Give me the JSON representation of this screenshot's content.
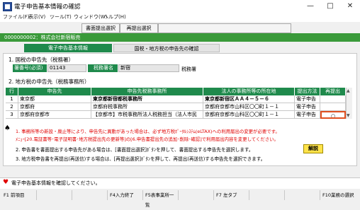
{
  "window": {
    "title": "電子申告基本情報の確認",
    "minimize_glyph": "—",
    "maximize_glyph": "□",
    "close_glyph": "✕"
  },
  "menu": [
    "ファイル(F)",
    "表示(V)",
    "ツール(T)",
    "ウィンドウ(W)",
    "ヘルプ(H)"
  ],
  "toolbar": {
    "button1": "書面提出選択",
    "button2": "再提出選択"
  },
  "company_line": "0000000002：株式会社新宿販売",
  "tabs": {
    "tab1": "電子申告基本情報",
    "tab2": "国税・地方税の申告先の確認"
  },
  "section1": {
    "title": "1. 国税の申告先（税務署）",
    "label_code": "署番号(必須)",
    "code_value": "01143",
    "label_office": "税務署名",
    "office_value": "新宿",
    "suffix": "税務署"
  },
  "section2": {
    "title": "2. 地方税の申告先（税務事務所）",
    "headers": [
      "行",
      "申告先",
      "申告先税務事務所",
      "法人の事務所等の所在地",
      "提出方法",
      "再提出"
    ],
    "rows": [
      {
        "no": "1",
        "dest": "東京都",
        "office": "東京都新宿都税事務所",
        "address": "東京都新宿区ＡＡ４－５－６",
        "method": "電子申告",
        "resubmit": ""
      },
      {
        "no": "2",
        "dest": "京都府",
        "office": "京都府税事務所",
        "address": "京都府京都市山科区〇〇町１－１",
        "method": "電子申告",
        "resubmit": ""
      },
      {
        "no": "3",
        "dest": "京都府京都市",
        "office": "【京都市】市税事務所法人税務担当（法人市民",
        "address": "京都府京都市山科区〇〇町１－１",
        "method": "電子申告",
        "resubmit": "○"
      }
    ]
  },
  "notes": {
    "note1_line1": "1. 事務所等の新設・廃止等により、申告先に異動があった場合は、必ず地方税ﾎﾟｰﾀﾙｼｽﾃﾑ(eLTAX)への利用届出の変更が必要です。",
    "note1_line2": "ﾒﾆｭｰ[20.電証書等･電子証明書･地方税提出先の更新等]の[6.申告書提出先の追加･削除･確認]で利用届出内容を変更してください。",
    "note2": "2. 申告書を書面提出する申告先がある場合は、[書面提出選択]ﾎﾞﾀﾝを押して、書面提出する申告先を選択します。",
    "note2_button": "解説",
    "note3": "3. 地方税申告書を再提出(再送信)する場合は、[再提出選択]ﾎﾞﾀﾝを押して、再提出(再送信)する申告先を選択できます。"
  },
  "status": {
    "message": "電子申告基本情報を確認してください。"
  },
  "fkeys": [
    "F1 前項目",
    "",
    "",
    "F4入力終了",
    "F5表事業所一覧",
    "",
    "F7 左タブ",
    "",
    "",
    "F10業務の選択"
  ],
  "colors": {
    "accent_green": "#1f8a4c",
    "header_green": "#3a9a3a",
    "note_red": "#e00000"
  }
}
